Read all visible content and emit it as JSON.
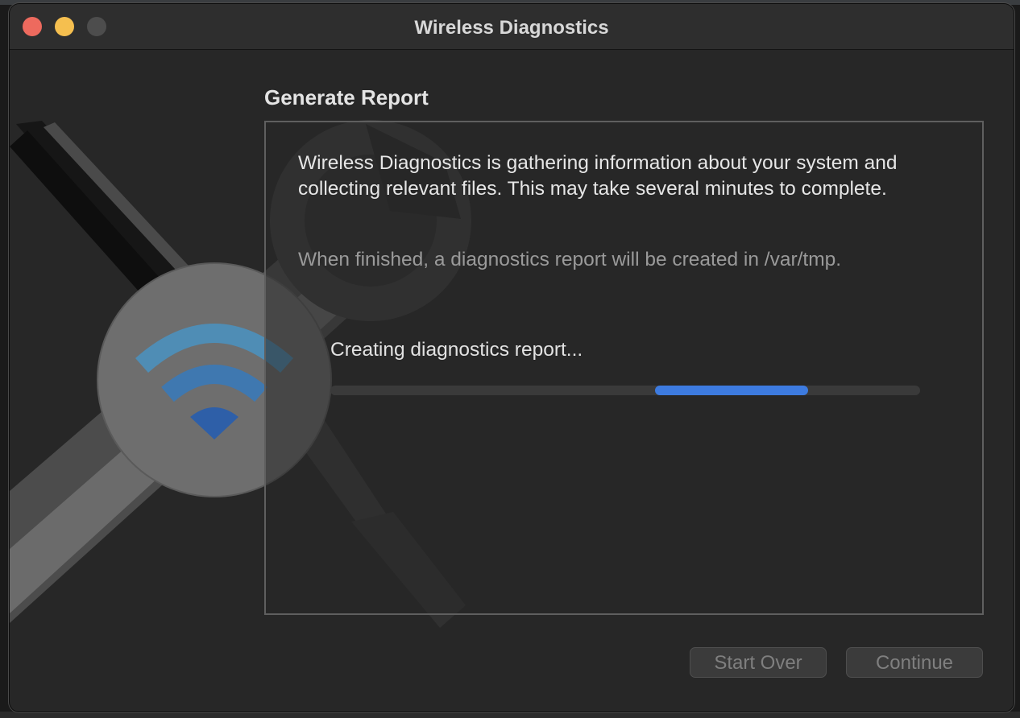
{
  "window": {
    "title": "Wireless Diagnostics"
  },
  "page": {
    "heading": "Generate Report",
    "description": "Wireless Diagnostics is gathering information about your system and collecting relevant files. This may take several minutes to complete.",
    "note": "When finished, a diagnostics report will be created in /var/tmp.",
    "status": "Creating diagnostics report...",
    "progress": {
      "indeterminate": true,
      "segment_start": 0.55,
      "segment_end": 0.81,
      "accent": "#3d7be0"
    }
  },
  "buttons": {
    "start_over": "Start Over",
    "continue": "Continue"
  },
  "icons": {
    "art": "wifi-tools-icon",
    "wifi": "wifi-icon"
  },
  "colors": {
    "close": "#ed6a5e",
    "minimize": "#f5bf4f",
    "zoom": "#4d4d4d"
  }
}
